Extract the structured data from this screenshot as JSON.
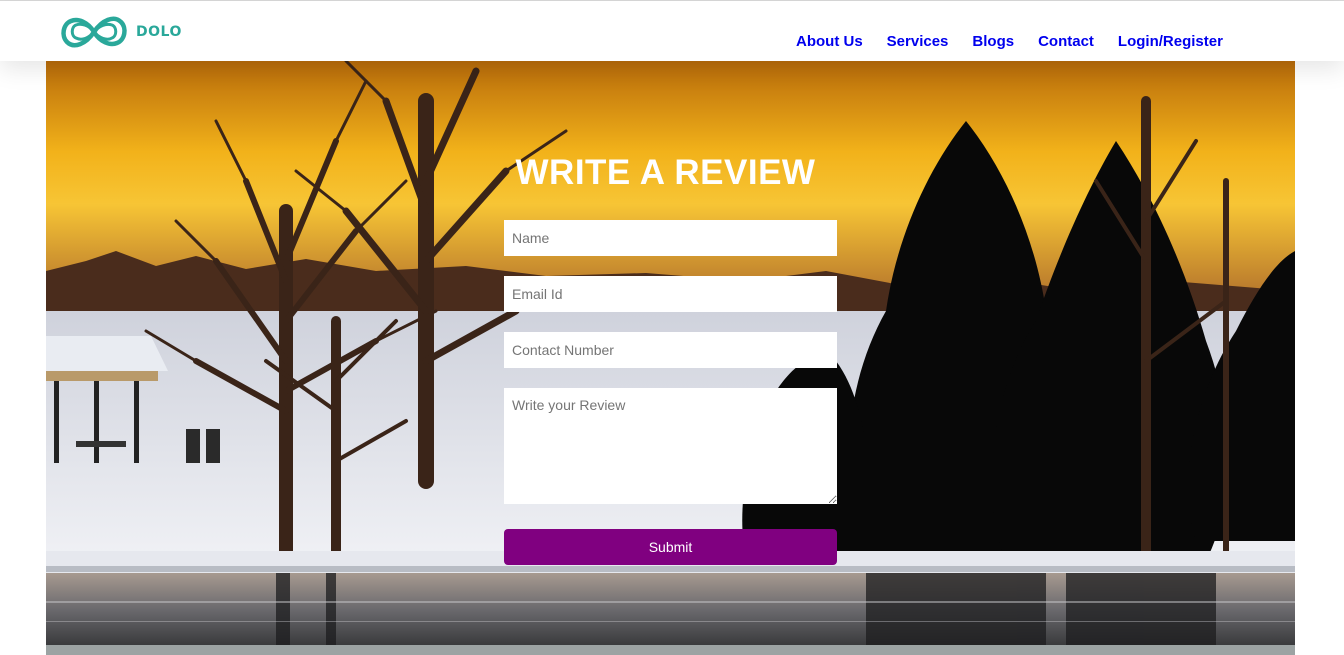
{
  "brand": {
    "name": "DOLO",
    "logo_icon": "infinity-icon",
    "accent_color": "#2aa89a"
  },
  "nav": {
    "items": [
      {
        "label": "About Us"
      },
      {
        "label": "Services"
      },
      {
        "label": "Blogs"
      },
      {
        "label": "Contact"
      },
      {
        "label": "Login/Register"
      }
    ],
    "link_color": "#0000ee"
  },
  "review_form": {
    "title": "WRITE A REVIEW",
    "name_placeholder": "Name",
    "email_placeholder": "Email Id",
    "contact_placeholder": "Contact Number",
    "review_placeholder": "Write your Review",
    "submit_label": "Submit",
    "submit_color": "#800080"
  }
}
